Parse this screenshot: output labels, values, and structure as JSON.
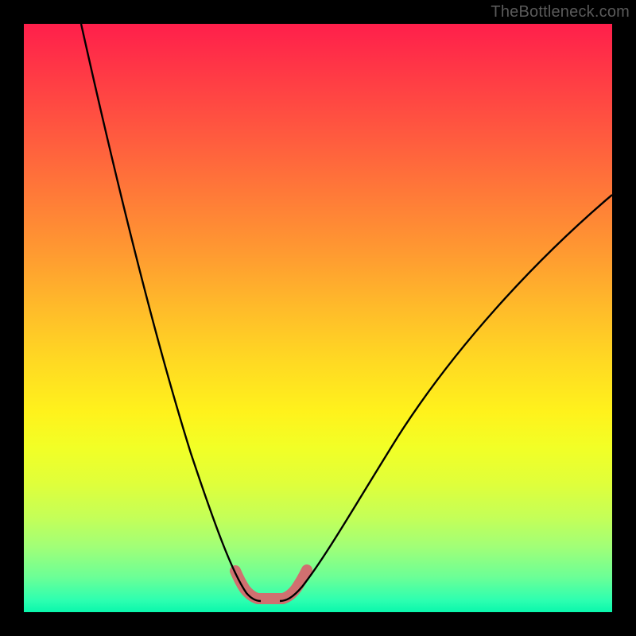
{
  "watermark": "TheBottleneck.com",
  "chart_data": {
    "type": "line",
    "title": "",
    "xlabel": "",
    "ylabel": "",
    "xlim": [
      0,
      100
    ],
    "ylim": [
      0,
      100
    ],
    "background_gradient": {
      "top_color": "#ff1f4b",
      "bottom_color": "#09f7ac",
      "meaning": "red-to-green vertical gradient"
    },
    "series": [
      {
        "name": "left-curve",
        "x": [
          10,
          13,
          16,
          19,
          22,
          25,
          28,
          31,
          33,
          35,
          36.5,
          38,
          39
        ],
        "y": [
          100,
          89,
          78,
          66,
          54,
          42,
          31,
          21,
          14,
          9,
          6,
          4,
          3
        ],
        "stroke": "#000000"
      },
      {
        "name": "right-curve",
        "x": [
          47,
          49,
          52,
          56,
          61,
          67,
          74,
          82,
          90,
          100
        ],
        "y": [
          3,
          4,
          7,
          12,
          19,
          28,
          38,
          49,
          59,
          71
        ],
        "stroke": "#000000"
      },
      {
        "name": "valley-marker",
        "x": [
          36,
          37,
          38,
          39,
          40,
          41,
          42,
          43,
          44,
          45,
          46,
          47,
          48
        ],
        "y": [
          7,
          5,
          3.5,
          2.7,
          2.3,
          2.1,
          2.1,
          2.2,
          2.5,
          3.2,
          4.2,
          5.5,
          7
        ],
        "stroke": "#d36a6a",
        "stroke_width_px": 14
      }
    ],
    "minimum": {
      "x": 42,
      "y": 2
    }
  }
}
